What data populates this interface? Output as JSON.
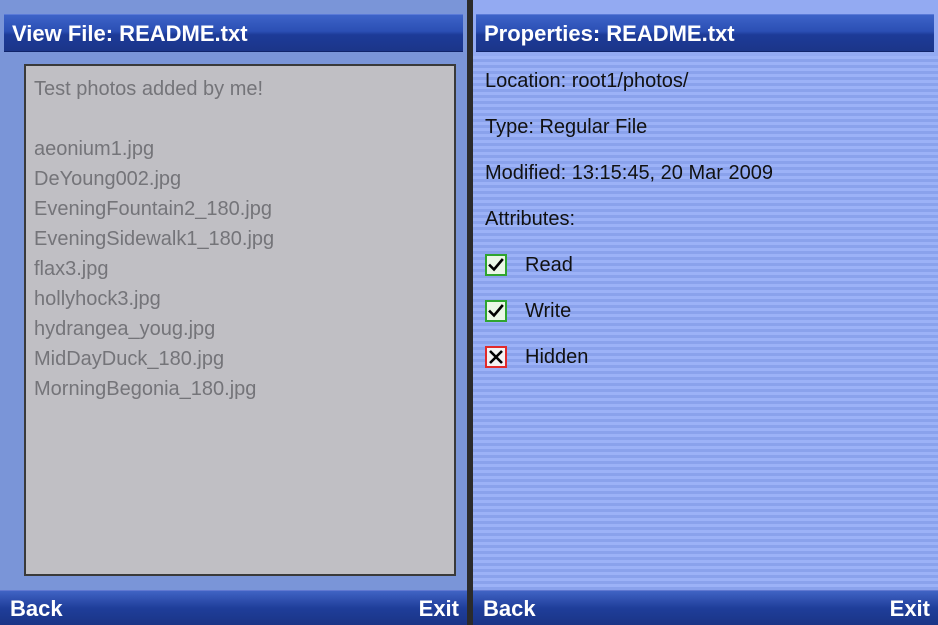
{
  "left_screen": {
    "title": "View File: README.txt",
    "content": {
      "heading": "Test photos added by me!",
      "files": [
        "aeonium1.jpg",
        "DeYoung002.jpg",
        "EveningFountain2_180.jpg",
        "EveningSidewalk1_180.jpg",
        "flax3.jpg",
        "hollyhock3.jpg",
        "hydrangea_youg.jpg",
        "MidDayDuck_180.jpg",
        "MorningBegonia_180.jpg"
      ]
    },
    "softkeys": {
      "left": "Back",
      "right": "Exit"
    }
  },
  "right_screen": {
    "title": "Properties: README.txt",
    "location": "Location: root1/photos/",
    "type": "Type:  Regular File",
    "modified": "Modified: 13:15:45, 20 Mar 2009",
    "attributes_label": "Attributes:",
    "attributes": [
      {
        "label": "Read",
        "checked": true,
        "icon": "check-icon"
      },
      {
        "label": "Write",
        "checked": true,
        "icon": "check-icon"
      },
      {
        "label": "Hidden",
        "checked": false,
        "icon": "cross-icon"
      }
    ],
    "softkeys": {
      "left": "Back",
      "right": "Exit"
    }
  },
  "colors": {
    "titlebar": "#2b4fb4",
    "viewer_bg": "#c0bfc4",
    "viewer_text": "#747479",
    "checked_border": "#2fa52f",
    "unchecked_border": "#e22a2a"
  }
}
